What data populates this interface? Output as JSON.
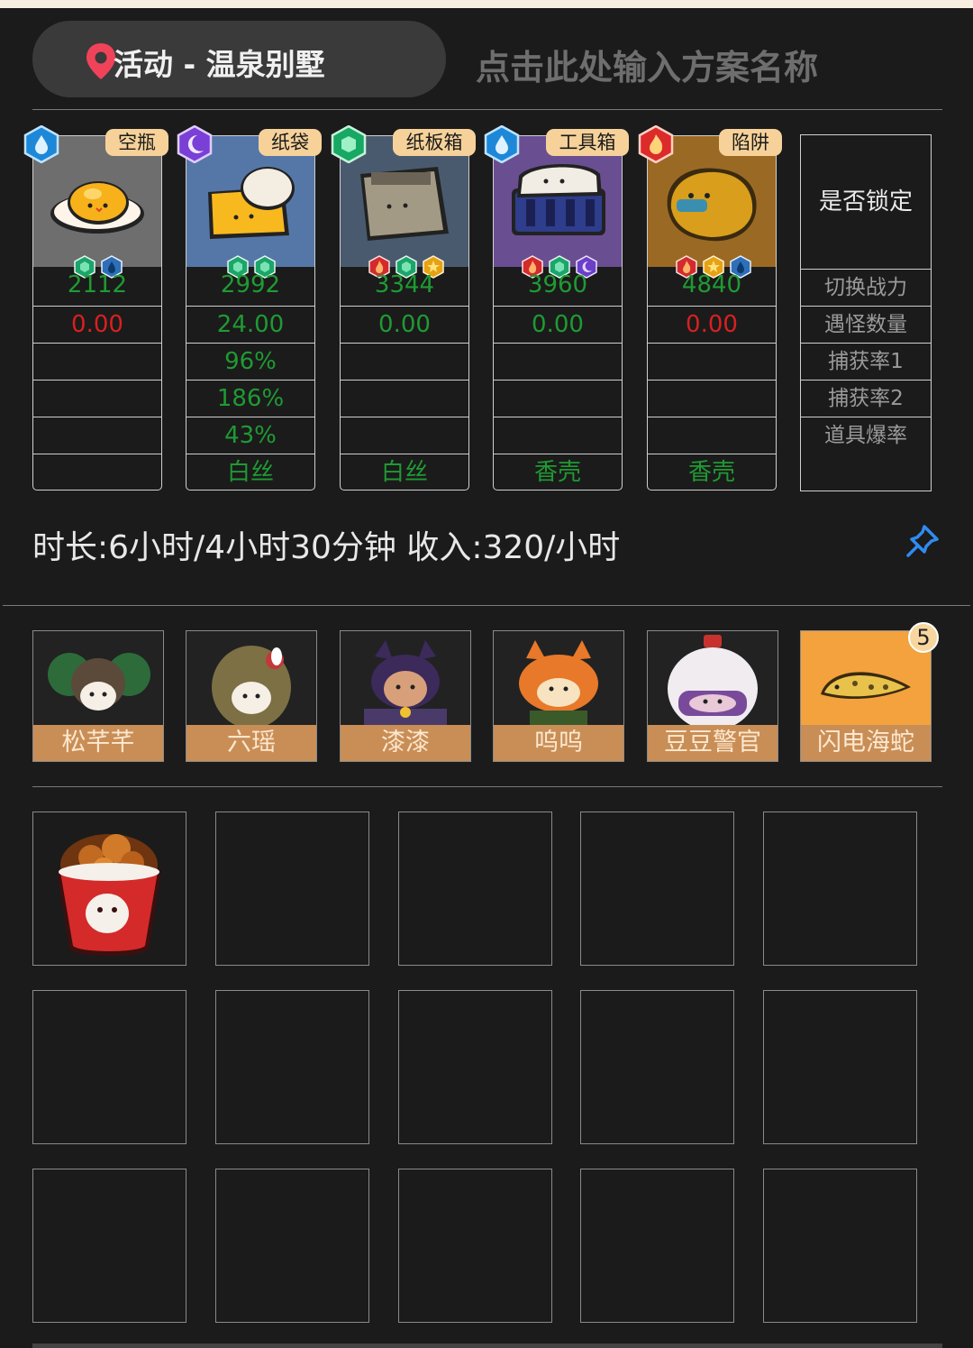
{
  "header": {
    "location": "活动 - 温泉别墅",
    "plan_placeholder": "点击此处输入方案名称"
  },
  "cards": [
    {
      "tag": "空瓶",
      "gem": "water",
      "power": "2112",
      "v1": "0.00",
      "v1_color": "red",
      "v2": "",
      "v3": "",
      "v4": "",
      "v5": "",
      "mini": [
        "leaf",
        "water"
      ]
    },
    {
      "tag": "纸袋",
      "gem": "moon",
      "power": "2992",
      "v1": "24.00",
      "v1_color": "green",
      "v2": "96%",
      "v3": "186%",
      "v4": "43%",
      "v5": "白丝",
      "mini": [
        "leaf",
        "leaf"
      ]
    },
    {
      "tag": "纸板箱",
      "gem": "leaf",
      "power": "3344",
      "v1": "0.00",
      "v1_color": "green",
      "v2": "",
      "v3": "",
      "v4": "",
      "v5": "白丝",
      "mini": [
        "fire",
        "leaf",
        "star"
      ]
    },
    {
      "tag": "工具箱",
      "gem": "water",
      "power": "3960",
      "v1": "0.00",
      "v1_color": "green",
      "v2": "",
      "v3": "",
      "v4": "",
      "v5": "香壳",
      "mini": [
        "fire",
        "leaf",
        "moon"
      ]
    },
    {
      "tag": "陷阱",
      "gem": "fire",
      "power": "4840",
      "v1": "0.00",
      "v1_color": "red",
      "v2": "",
      "v3": "",
      "v4": "",
      "v5": "香壳",
      "mini": [
        "fire",
        "star",
        "water"
      ]
    }
  ],
  "lock_panel": {
    "title": "是否锁定",
    "rows": [
      "切换战力",
      "遇怪数量",
      "捕获率1",
      "捕获率2",
      "道具爆率"
    ]
  },
  "summary": "时长:6小时/4小时30分钟 收入:320/小时",
  "pets": [
    "松芊芊",
    "六瑶",
    "漆漆",
    "呜呜",
    "豆豆警官",
    "闪电海蛇"
  ],
  "pet_badge": "5",
  "colors": {
    "background": "#1b1b1b",
    "green_value": "#1f9a33",
    "red_value": "#d82020",
    "tag_bg": "#f6d29a",
    "pet_label_bg": "#c98e56",
    "pin_blue": "#2f8cf0"
  }
}
